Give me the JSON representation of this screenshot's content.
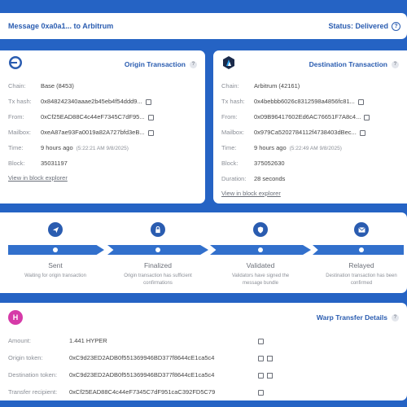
{
  "header": {
    "title": "Message 0xa0a1... to Arbitrum",
    "status": "Status: Delivered",
    "status_help": "?"
  },
  "origin": {
    "title": "Origin Transaction",
    "help": "?",
    "rows": [
      {
        "key": "Chain:",
        "value": "Base (8453)"
      },
      {
        "key": "Tx hash:",
        "value": "0x848242340aaae2b45eb4f54ddd9..."
      },
      {
        "key": "From:",
        "value": "0xCf25EAD88C4c44eF7345C7dF95..."
      },
      {
        "key": "Mailbox:",
        "value": "0xeA87ae93Fa0019a82A727bfd3eB..."
      },
      {
        "key": "Time:",
        "value": "9 hours ago",
        "extra": "(5:22:21 AM 9/8/2025)"
      },
      {
        "key": "Block:",
        "value": "35031197"
      }
    ],
    "explorer_link": "View in block explorer"
  },
  "destination": {
    "title": "Destination Transaction",
    "help": "?",
    "rows": [
      {
        "key": "Chain:",
        "value": "Arbitrum (42161)"
      },
      {
        "key": "Tx hash:",
        "value": "0x4bebbb6026c8312598a4856fc81..."
      },
      {
        "key": "From:",
        "value": "0x09B96417602Ed6AC76651F7A8c4..."
      },
      {
        "key": "Mailbox:",
        "value": "0x979Ca5202784112f4738403dBec..."
      },
      {
        "key": "Time:",
        "value": "9 hours ago",
        "extra": "(5:22:49 AM 9/8/2025)"
      },
      {
        "key": "Block:",
        "value": "375052630"
      },
      {
        "key": "Duration:",
        "value": "28 seconds"
      }
    ],
    "explorer_link": "View in block explorer"
  },
  "stages": [
    {
      "name": "Sent",
      "desc": "Waiting for origin transaction",
      "icon": "send-icon"
    },
    {
      "name": "Finalized",
      "desc": "Origin transaction has sufficient confirmations",
      "icon": "lock-icon"
    },
    {
      "name": "Validated",
      "desc": "Validators have signed the message bundle",
      "icon": "shield-icon"
    },
    {
      "name": "Relayed",
      "desc": "Destination transaction has been confirmed",
      "icon": "envelope-icon"
    }
  ],
  "warp": {
    "title": "Warp Transfer Details",
    "help": "?",
    "logo_letter": "H",
    "rows": [
      {
        "key": "Amount:",
        "value": "1.441 HYPER"
      },
      {
        "key": "Origin token:",
        "value": "0xC9d23ED2ADB0f551369946BD377f8644cE1ca5c4"
      },
      {
        "key": "Destination token:",
        "value": "0xC9d23ED2ADB0f551369946BD377f8644cE1ca5c4"
      },
      {
        "key": "Transfer recipient:",
        "value": "0xCf25EAD88C4c44eF7345C7dF951caC392FD5C79"
      }
    ]
  },
  "colors": {
    "background": "#2563c4",
    "accent": "#2a5cb0",
    "hyper": "#d63aa8"
  }
}
